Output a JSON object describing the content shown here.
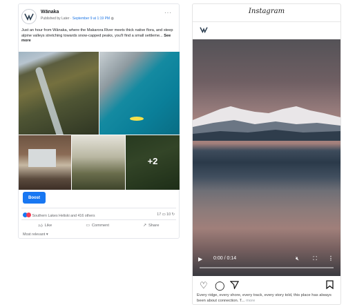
{
  "facebook": {
    "page_name": "Wānaka",
    "published_by": "Published by Later",
    "date": "September 9 at 1:19 PM",
    "post_text": "Just an hour from Wānaka, where the Makarora River meets thick native flora, and steep alpine valleys stretching towards snow-capped peaks, you'll find a small settleme...",
    "see_more": "See more",
    "more_photos_count": "+2",
    "boost_label": "Boost",
    "reactions_text": "Southern Lakes Heliski and 416 others",
    "comments_count": "17",
    "shares_count": "10",
    "actions": [
      "Like",
      "Comment",
      "Share"
    ],
    "sort_label": "Most relevant",
    "more_icon": "ellipsis-icon"
  },
  "instagram": {
    "title": "Instagram",
    "video_time": "0:00 / 0:14",
    "progress": 0,
    "caption": "Every ridge, every shore, every track, every story told, this place has always been about connection. T...",
    "caption_more": "more"
  }
}
